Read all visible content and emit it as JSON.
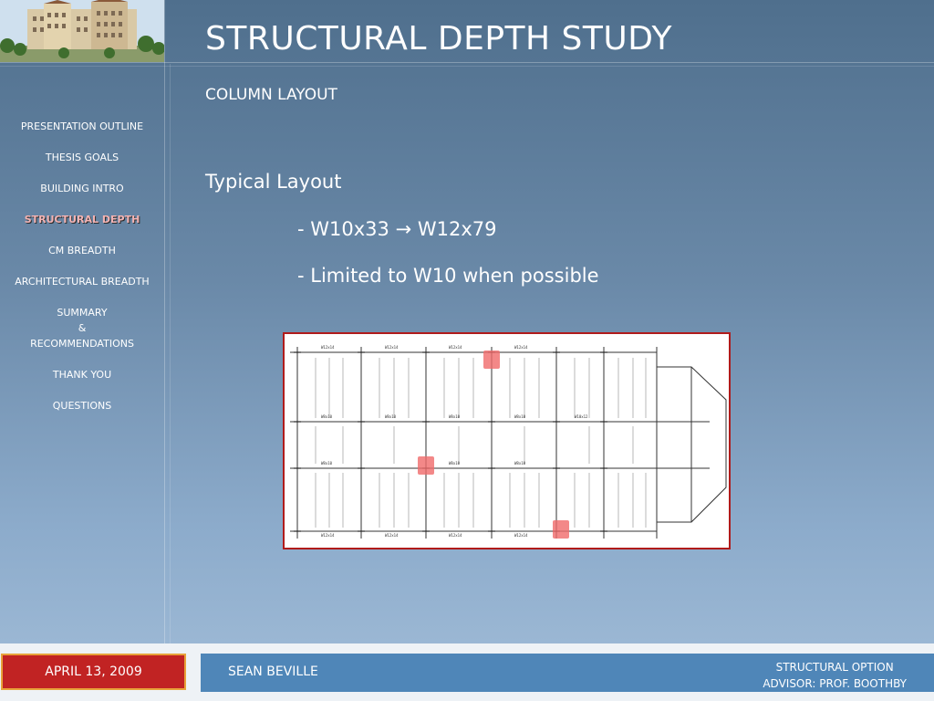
{
  "title": "STRUCTURAL DEPTH STUDY",
  "subtitle": "COLUMN LAYOUT",
  "content": {
    "heading": "Typical Layout",
    "bullets": [
      "- W10x33 → W12x79",
      "- Limited to W10 when possible"
    ]
  },
  "nav": {
    "items": [
      {
        "label": "PRESENTATION OUTLINE"
      },
      {
        "label": "THESIS GOALS"
      },
      {
        "label": "BUILDING INTRO"
      },
      {
        "label": "STRUCTURAL DEPTH",
        "active": true
      },
      {
        "label": "CM BREADTH"
      },
      {
        "label": "ARCHITECTURAL BREADTH"
      },
      {
        "label": "SUMMARY"
      },
      {
        "label": "THANK YOU"
      },
      {
        "label": "QUESTIONS"
      }
    ],
    "summary_lines": [
      "SUMMARY",
      "&",
      "RECOMMENDATIONS"
    ]
  },
  "footer": {
    "date": "APRIL 13, 2009",
    "author": "SEAN BEVILLE",
    "option": "STRUCTURAL OPTION",
    "advisor": "ADVISOR:  PROF. BOOTHBY"
  },
  "colors": {
    "accent_red": "#c12323",
    "footer_blue": "#4f86b8",
    "active_nav": "#f3b3b3",
    "highlight": "#f06a6a"
  },
  "plan_image": {
    "beam_labels": [
      "W12x14",
      "W8x10",
      "W12x14",
      "W8x10",
      "W10x12",
      "W16x26",
      "W8x10"
    ],
    "highlighted_columns": 3
  }
}
